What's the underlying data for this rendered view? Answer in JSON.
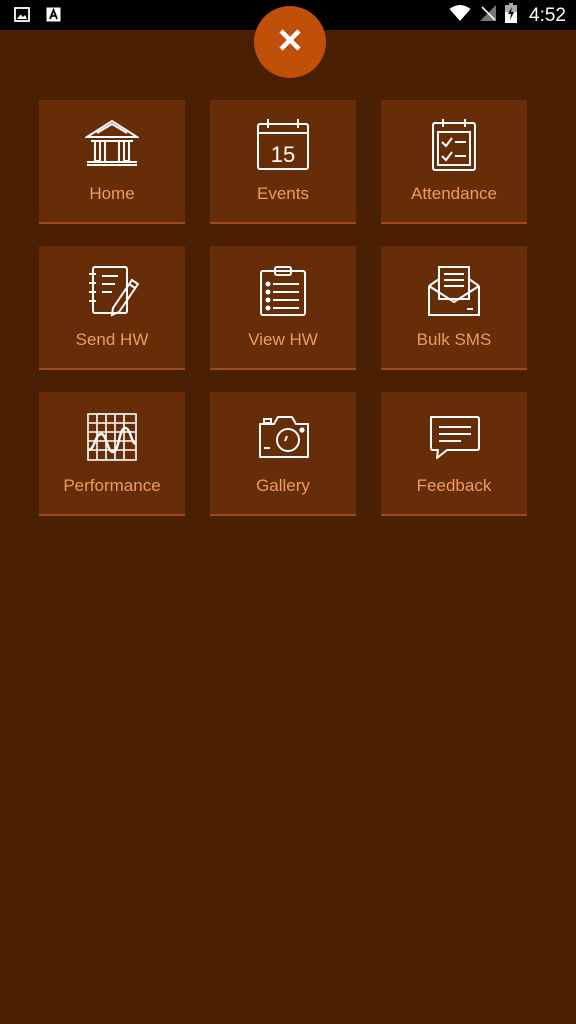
{
  "status_bar": {
    "time": "4:52",
    "left_icons": [
      "image-icon",
      "text-a-icon"
    ],
    "right_icons": [
      "wifi-icon",
      "no-signal-icon",
      "battery-charging-icon"
    ]
  },
  "menu": {
    "close_icon": "close-icon",
    "items": [
      {
        "label": "Home",
        "icon": "school-building-icon"
      },
      {
        "label": "Events",
        "icon": "calendar-icon"
      },
      {
        "label": "Attendance",
        "icon": "checklist-clipboard-icon"
      },
      {
        "label": "Send HW",
        "icon": "notebook-pencil-icon"
      },
      {
        "label": "View HW",
        "icon": "clipboard-list-icon"
      },
      {
        "label": "Bulk SMS",
        "icon": "envelope-letter-icon"
      },
      {
        "label": "Performance",
        "icon": "graph-chart-icon"
      },
      {
        "label": "Gallery",
        "icon": "camera-icon"
      },
      {
        "label": "Feedback",
        "icon": "chat-bubble-icon"
      }
    ]
  },
  "colors": {
    "background": "#4a1f02",
    "tile": "#672c08",
    "tile_border": "#9c4c18",
    "label": "#ee9a60",
    "close_button": "#c04f0a",
    "status_bar": "#000000"
  }
}
